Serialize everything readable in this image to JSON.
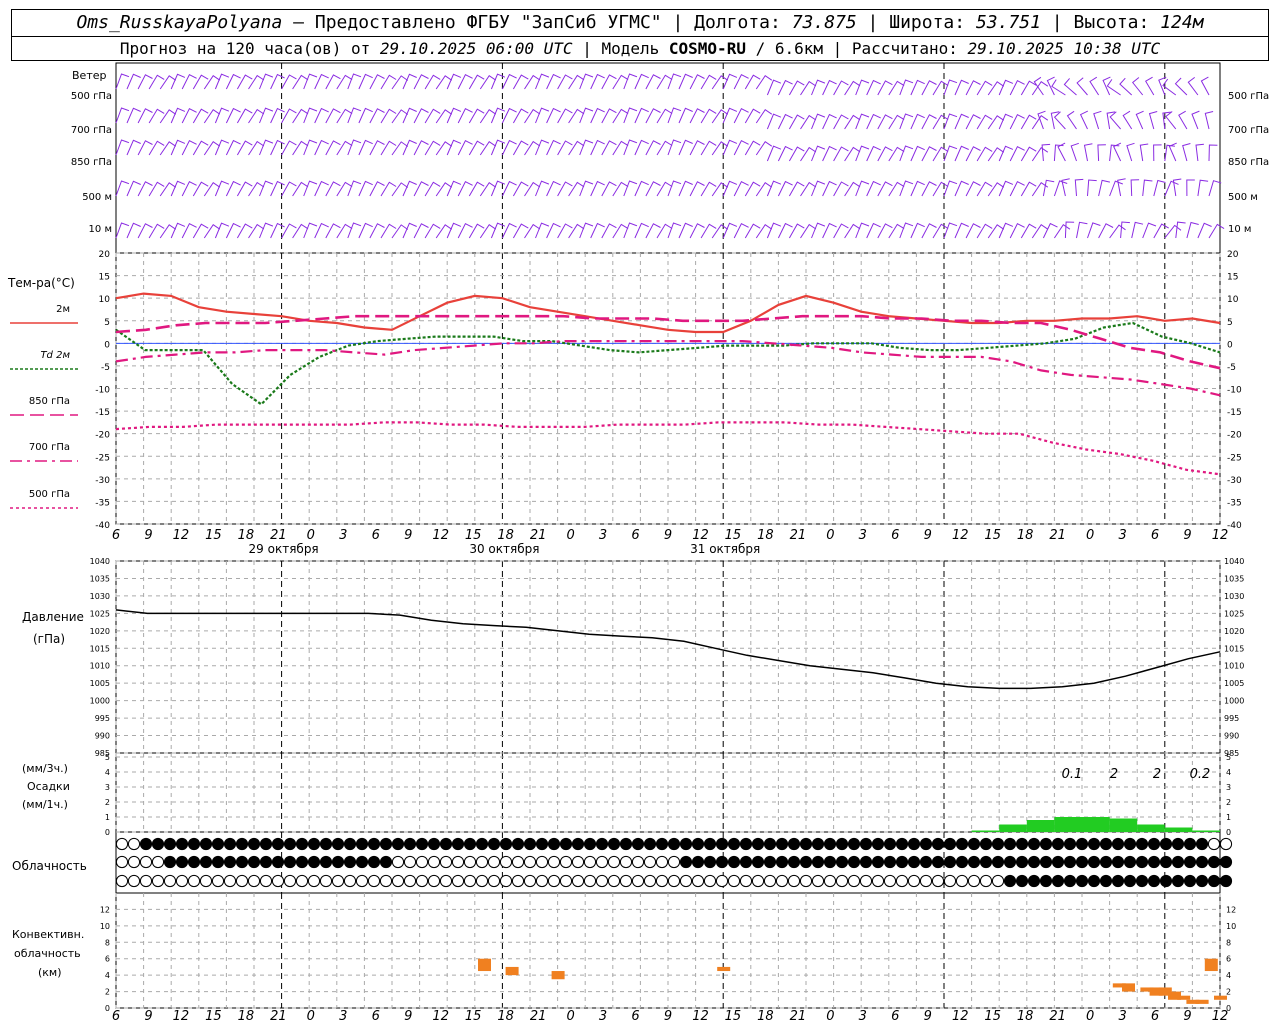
{
  "header": {
    "station": "Oms_RusskayaPolyana",
    "sep1": " – Предоставлено ФГБУ \"ЗапСиб УГМС\" | Долгота: ",
    "lon": "73.875",
    "sep2": " | Широта: ",
    "lat": "53.751",
    "sep3": " | Высота: ",
    "alt": "124м",
    "fc_prefix": "Прогноз на 120 часа(ов) от ",
    "fc_start": "29.10.2025 06:00 UTC",
    "model_prefix": " | Модель ",
    "model": "COSMO-RU",
    "model_res": " / 6.6км | Рассчитано: ",
    "calc": "29.10.2025 10:38 UTC"
  },
  "labels": {
    "wind_title": "Ветер",
    "wind_levels": [
      "500 гПа",
      "700 гПа",
      "850 гПа",
      "500 м",
      "10  м"
    ],
    "temp_title": "Тем-ра(°C)",
    "temp_legend": [
      "2м",
      "Td  2м",
      "850 гПа",
      "700 гПа",
      "500 гПа"
    ],
    "pressure_title": [
      "Давление",
      "(гПа)"
    ],
    "precip_title": [
      "(мм/3ч.)",
      "Осадки",
      "(мм/1ч.)"
    ],
    "cloud_title": "Облачность",
    "conv_title": [
      "Конвективн.",
      "облачность",
      "(км)"
    ],
    "precip_totals": [
      "0.1",
      "2",
      "2",
      "0.2"
    ],
    "days": [
      "29 октября",
      "30 октября",
      "31 октября"
    ]
  },
  "colors": {
    "t2m": "#e8413a",
    "td2m": "#1a7a1a",
    "t850": "#e01880",
    "wind": "#8a2be2",
    "precip": "#22cc22",
    "conv": "#f08020"
  },
  "chart_data": [
    {
      "type": "line",
      "panel": "temperature",
      "x_hours": [
        0,
        3,
        6,
        9,
        12,
        15,
        18,
        21,
        24,
        27,
        30,
        33,
        36,
        39,
        42,
        45,
        48,
        51,
        54,
        57,
        60,
        63,
        66,
        69,
        72,
        75,
        78,
        81,
        84,
        87,
        90,
        93,
        96,
        99,
        102,
        105,
        108,
        111,
        114,
        117,
        120
      ],
      "x_tick_labels": [
        "6",
        "9",
        "12",
        "15",
        "18",
        "21",
        "0",
        "3",
        "6",
        "9",
        "12",
        "15",
        "18",
        "21",
        "0",
        "3",
        "6",
        "9",
        "12",
        "15",
        "18",
        "21",
        "0",
        "3",
        "6",
        "9",
        "12",
        "15",
        "18",
        "21",
        "0",
        "3",
        "6",
        "9",
        "12"
      ],
      "ylim": [
        -40,
        20
      ],
      "y_ticks": [
        -40,
        -35,
        -30,
        -25,
        -20,
        -15,
        -10,
        -5,
        0,
        5,
        10,
        15,
        20
      ],
      "series": [
        {
          "name": "2м",
          "values": [
            10,
            11,
            10.5,
            8,
            7,
            6.5,
            6,
            5,
            4.5,
            3.5,
            3,
            6,
            9,
            10.5,
            10,
            8,
            7,
            6,
            5,
            4,
            3,
            2.5,
            2.5,
            5,
            8.5,
            10.5,
            9,
            7,
            6,
            5.5,
            5,
            4.5,
            4.5,
            5,
            5,
            5.5,
            5.5,
            6,
            5,
            5.5,
            4.5
          ]
        },
        {
          "name": "Td  2м",
          "values": [
            3,
            -1.5,
            -1.5,
            -1.5,
            -9,
            -13.5,
            -7,
            -3,
            -0.5,
            0.5,
            1,
            1.5,
            1.5,
            1.5,
            0.5,
            0.5,
            -0.5,
            -1.5,
            -2,
            -1.5,
            -1,
            -0.5,
            -0.5,
            -0.5,
            0,
            0,
            0,
            -1,
            -1.5,
            -1.5,
            -1,
            -0.5,
            0,
            1,
            3.5,
            4.5,
            1.5,
            0,
            -2
          ]
        },
        {
          "name": "850 гПа",
          "values": [
            2.5,
            3,
            4,
            4.5,
            4.5,
            4.5,
            5,
            5.5,
            6,
            6,
            6,
            6,
            6,
            6,
            6,
            6,
            5.5,
            5.5,
            5.5,
            5,
            5,
            5,
            5.5,
            6,
            6,
            6,
            5.5,
            5.5,
            5,
            5,
            4.5,
            4.5,
            3,
            1,
            -1,
            -2,
            -4,
            -5.5
          ]
        },
        {
          "name": "700 гПа",
          "values": [
            -4,
            -3,
            -2.5,
            -2,
            -2,
            -1.5,
            -1.5,
            -1.5,
            -2,
            -2.5,
            -1.5,
            -1,
            -0.5,
            0,
            0,
            0.5,
            0.5,
            0.5,
            0.5,
            0.5,
            0.5,
            0.5,
            0,
            -0.5,
            -1,
            -2,
            -2.5,
            -3,
            -3,
            -3,
            -4,
            -6,
            -7,
            -7.5,
            -8,
            -9,
            -10,
            -11.5
          ]
        },
        {
          "name": "500 гПа",
          "values": [
            -19,
            -18.5,
            -18.5,
            -18,
            -18,
            -18,
            -18,
            -18,
            -17.5,
            -17.5,
            -18,
            -18,
            -18.5,
            -18.5,
            -18.5,
            -18,
            -18,
            -18,
            -17.5,
            -17.5,
            -17.5,
            -18,
            -18,
            -18.5,
            -19,
            -19.5,
            -20,
            -20,
            -22,
            -23.5,
            -24.5,
            -26,
            -28,
            -29
          ]
        }
      ]
    },
    {
      "type": "line",
      "panel": "pressure",
      "series": [
        {
          "name": "Давление",
          "values": [
            1026,
            1025,
            1025,
            1025,
            1025,
            1025,
            1025,
            1025,
            1025,
            1024.5,
            1023,
            1022,
            1021.5,
            1021,
            1020,
            1019,
            1018.5,
            1018,
            1017,
            1015,
            1013,
            1011.5,
            1010,
            1009,
            1008,
            1006.5,
            1005,
            1004,
            1003.5,
            1003.5,
            1004,
            1005,
            1007,
            1009.5,
            1012,
            1014
          ]
        }
      ],
      "ylim": [
        985,
        1040
      ],
      "y_ticks": [
        985,
        990,
        995,
        1000,
        1005,
        1010,
        1015,
        1020,
        1025,
        1030,
        1035,
        1040
      ]
    },
    {
      "type": "bar",
      "panel": "precipitation",
      "values": [
        0,
        0,
        0,
        0,
        0,
        0,
        0,
        0,
        0,
        0,
        0,
        0,
        0,
        0,
        0,
        0,
        0,
        0,
        0,
        0,
        0,
        0,
        0,
        0,
        0,
        0,
        0,
        0,
        0,
        0,
        0,
        0.1,
        0.5,
        0.8,
        1,
        1,
        0.9,
        0.5,
        0.3,
        0.1
      ],
      "ylim": [
        0,
        5
      ],
      "y_ticks": [
        0,
        1,
        2,
        3,
        4,
        5
      ]
    },
    {
      "type": "bar",
      "panel": "convective_clouds",
      "bars": [
        {
          "x": 40,
          "base": 4.5,
          "top": 6
        },
        {
          "x": 43,
          "base": 4,
          "top": 5
        },
        {
          "x": 48,
          "base": 3.5,
          "top": 4.5
        },
        {
          "x": 66,
          "base": 4.5,
          "top": 5
        },
        {
          "x": 109,
          "base": 2.5,
          "top": 3
        },
        {
          "x": 110,
          "base": 2,
          "top": 3
        },
        {
          "x": 112,
          "base": 2,
          "top": 2.5
        },
        {
          "x": 113,
          "base": 1.5,
          "top": 2.5
        },
        {
          "x": 114,
          "base": 1.5,
          "top": 2.5
        },
        {
          "x": 115,
          "base": 1,
          "top": 2
        },
        {
          "x": 116,
          "base": 1,
          "top": 1.5
        },
        {
          "x": 117,
          "base": 0.5,
          "top": 1
        },
        {
          "x": 118,
          "base": 0.5,
          "top": 1
        },
        {
          "x": 119,
          "base": 4.5,
          "top": 6
        },
        {
          "x": 120,
          "base": 1,
          "top": 1.5
        }
      ],
      "ylim": [
        0,
        14
      ],
      "y_ticks": [
        0,
        2,
        4,
        6,
        8,
        10,
        12
      ]
    }
  ]
}
